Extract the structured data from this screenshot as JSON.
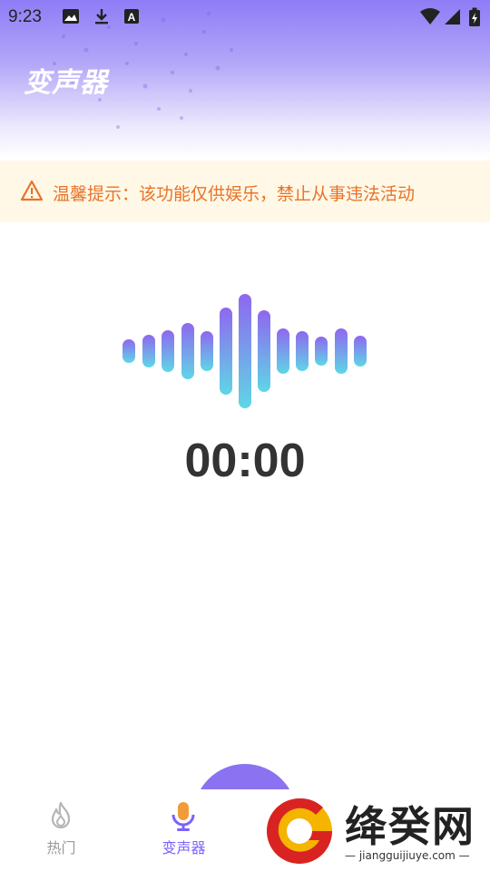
{
  "status_bar": {
    "time": "9:23"
  },
  "header": {
    "title": "变声器"
  },
  "notice": {
    "text": "温馨提示：该功能仅供娱乐，禁止从事违法活动"
  },
  "recorder": {
    "timer": "00:00"
  },
  "tabs": [
    {
      "label": "热门",
      "icon": "flame-icon",
      "active": false
    },
    {
      "label": "变声器",
      "icon": "microphone-icon",
      "active": true
    }
  ],
  "watermark": {
    "brand": "绛癸网",
    "url": "jiangguijiuye.com"
  },
  "colors": {
    "accent": "#7b61ff",
    "notice_text": "#e8732a",
    "notice_bg": "#fff8e6",
    "inactive": "#999999"
  }
}
